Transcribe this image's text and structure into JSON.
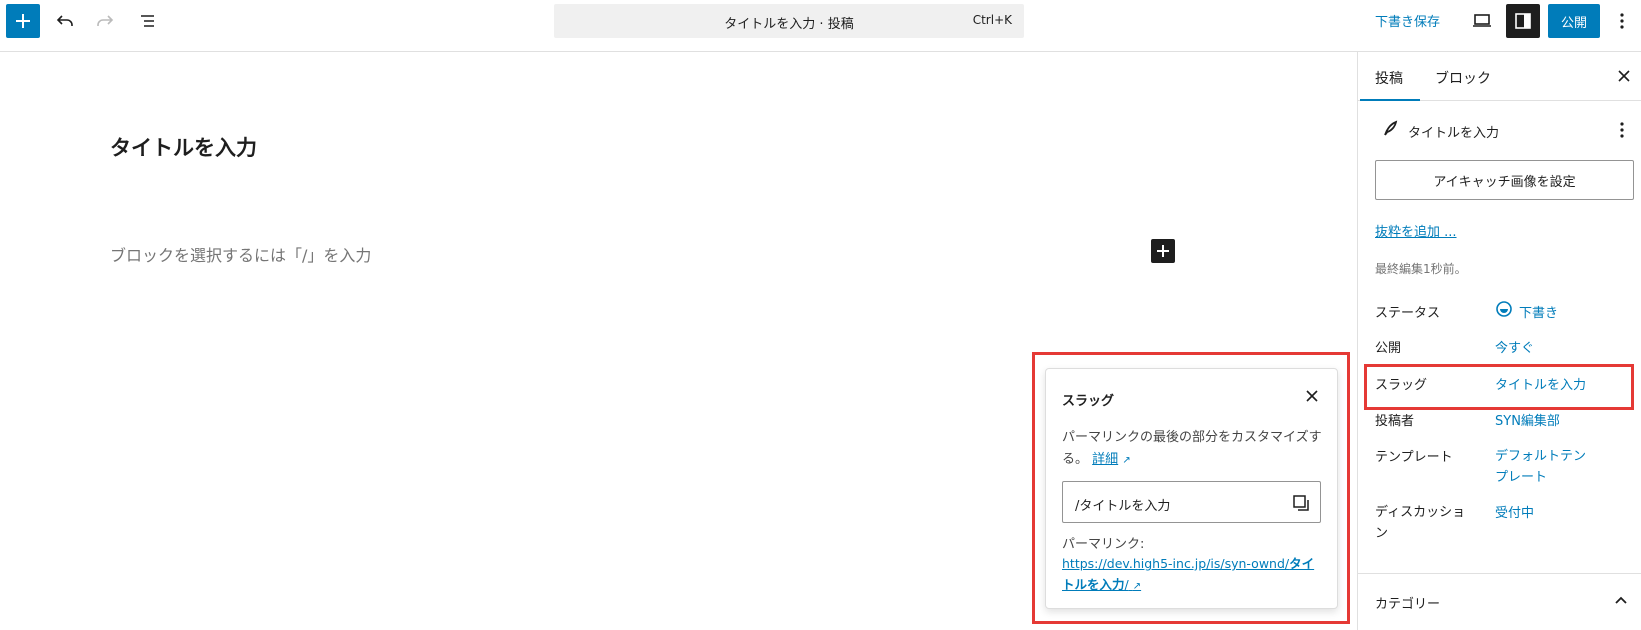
{
  "toolbar": {
    "command_title": "タイトルを入力 · 投稿",
    "command_shortcut": "Ctrl+K",
    "save_draft_label": "下書き保存",
    "publish_label": "公開"
  },
  "canvas": {
    "title": "タイトルを入力",
    "block_placeholder": "ブロックを選択するには「/」を入力"
  },
  "slug_popover": {
    "title": "スラッグ",
    "description": "パーマリンクの最後の部分をカスタマイズする。",
    "detail_link": "詳細",
    "input_value": "/タイトルを入力",
    "permalink_label": "パーマリンク:",
    "permalink_base": "https://dev.high5-inc.jp/is/syn-ownd/",
    "permalink_slug": "タイトルを入力",
    "permalink_trailing": "/"
  },
  "sidebar": {
    "tabs": [
      {
        "label": "投稿"
      },
      {
        "label": "ブロック"
      }
    ],
    "doc_title": "タイトルを入力",
    "featured_image_button": "アイキャッチ画像を設定",
    "excerpt_link": "抜粋を追加 ...",
    "last_edited": "最終編集1秒前。",
    "rows": [
      {
        "label": "ステータス",
        "value": "下書き"
      },
      {
        "label": "公開",
        "value": "今すぐ"
      },
      {
        "label": "スラッグ",
        "value": "タイトルを入力"
      },
      {
        "label": "投稿者",
        "value": "SYN編集部"
      },
      {
        "label": "テンプレート",
        "value": "デフォルトテンプレート"
      },
      {
        "label": "ディスカッション",
        "value": "受付中"
      }
    ],
    "category_panel": "カテゴリー"
  },
  "colors": {
    "accent": "#007cba",
    "highlight": "#e53935"
  }
}
